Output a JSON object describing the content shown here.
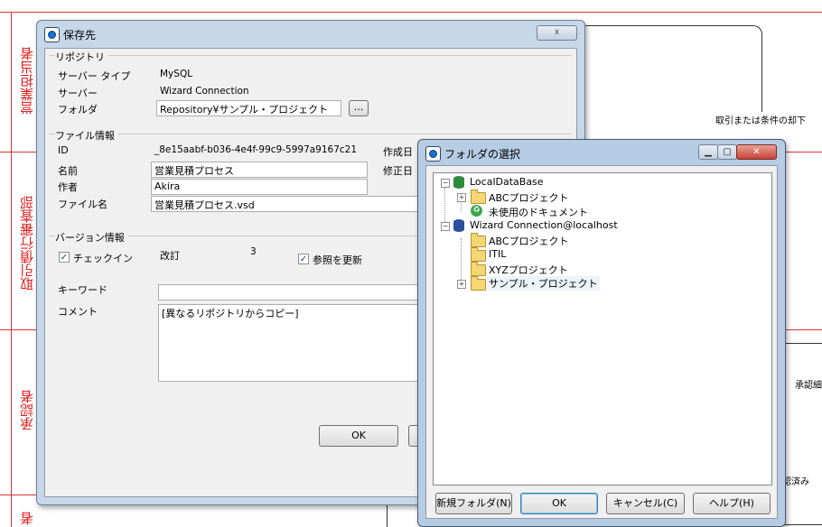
{
  "background": {
    "lanes": [
      "営業担当者",
      "取引債行審査部",
      "承認者",
      "者"
    ],
    "texts": {
      "reject_label": "取引または条件の却下",
      "approval_label": "承認細",
      "approved_label": "認済み"
    }
  },
  "save_dialog": {
    "title": "保存先",
    "close_symbol": "☓",
    "repository": {
      "caption": "リポジトリ",
      "server_type_label": "サーバー タイプ",
      "server_type_value": "MySQL",
      "server_label": "サーバー",
      "server_value": "Wizard Connection",
      "folder_label": "フォルダ",
      "folder_value": "Repository¥サンプル・プロジェクト",
      "browse_label": "..."
    },
    "file_info": {
      "caption": "ファイル情報",
      "id_label": "ID",
      "id_value": "_8e15aabf-b036-4e4f-99c9-5997a9167c21",
      "name_label": "名前",
      "name_value": "営業見積プロセス",
      "author_label": "作者",
      "author_value": "Akira",
      "filename_label": "ファイル名",
      "filename_value": "営業見積プロセス.vsd",
      "created_label": "作成日",
      "modified_label": "修正日"
    },
    "version": {
      "caption": "バージョン情報",
      "checkin_label": "チェックイン",
      "checkin_checked": true,
      "revision_label": "改訂",
      "revision_value": "3",
      "update_ref_label": "参照を更新",
      "update_ref_checked": true
    },
    "keyword_label": "キーワード",
    "keyword_value": "",
    "comment_label": "コメント",
    "comment_value": "[異なるリポジトリからコピー]",
    "ok_label": "OK"
  },
  "folder_dialog": {
    "title": "フォルダの選択",
    "minimize_symbol": "▁",
    "maximize_symbol": "▢",
    "close_symbol": "✕",
    "tree": [
      {
        "label": "LocalDataBase",
        "level": 0,
        "expander": "−",
        "icon": "database-green-icon"
      },
      {
        "label": "ABCプロジェクト",
        "level": 1,
        "expander": "+",
        "icon": "folder-icon"
      },
      {
        "label": "未使用のドキュメント",
        "level": 1,
        "expander": "",
        "icon": "recycle-icon"
      },
      {
        "label": "Wizard Connection@localhost",
        "level": 0,
        "expander": "−",
        "icon": "database-blue-icon"
      },
      {
        "label": "ABCプロジェクト",
        "level": 1,
        "expander": "",
        "icon": "folder-icon"
      },
      {
        "label": "ITIL",
        "level": 1,
        "expander": "",
        "icon": "folder-icon"
      },
      {
        "label": "XYZプロジェクト",
        "level": 1,
        "expander": "",
        "icon": "folder-icon"
      },
      {
        "label": "サンプル・プロジェクト",
        "level": 1,
        "expander": "+",
        "icon": "folder-icon",
        "selected": true
      }
    ],
    "new_folder_label": "新規フォルダ(N)",
    "ok_label": "OK",
    "cancel_label": "キャンセル(C)",
    "help_label": "ヘルプ(H)"
  }
}
